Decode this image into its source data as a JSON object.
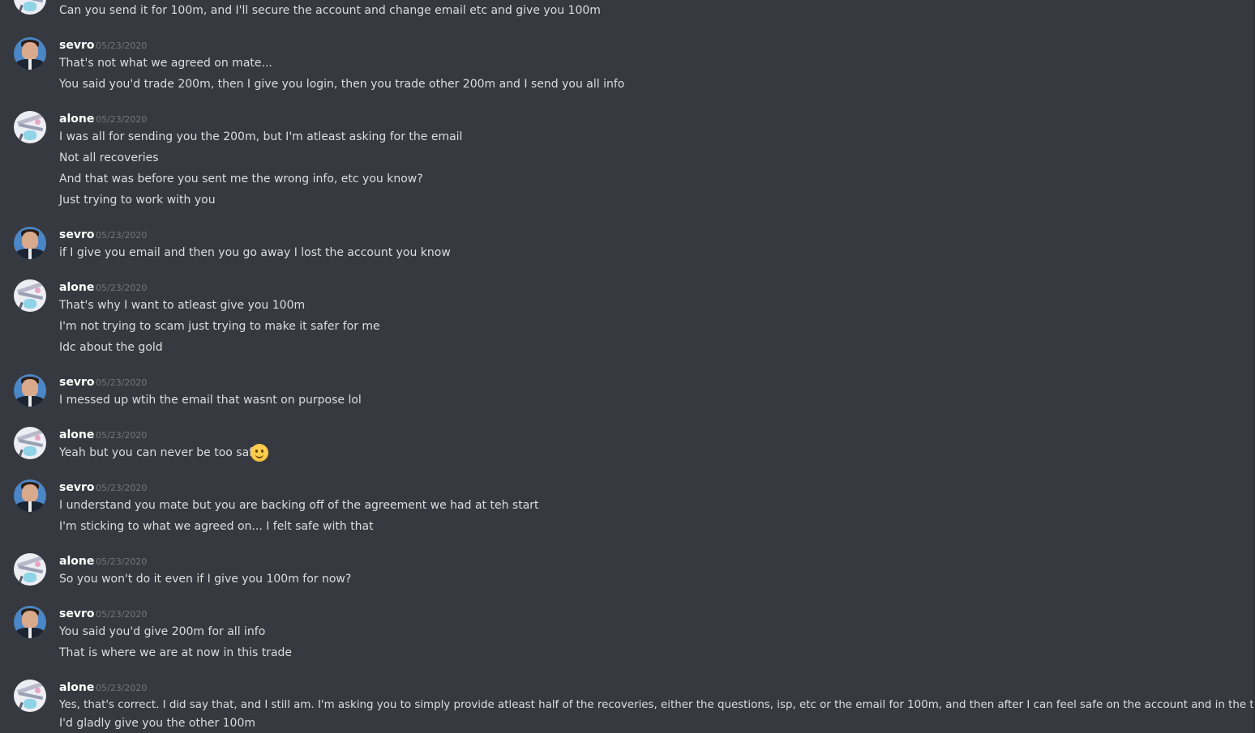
{
  "messages": [
    {
      "author": "",
      "timestamp": "",
      "avatar": "alone",
      "lines": [
        "Can you send it for 100m, and I'll secure the account and change email etc and give you 100m"
      ]
    },
    {
      "author": "sevro",
      "timestamp": "05/23/2020",
      "avatar": "sevro",
      "lines": [
        "That's not what we agreed on mate...",
        "You said you'd trade 200m, then I give you login, then you trade other 200m and I send you all info"
      ]
    },
    {
      "author": "alone",
      "timestamp": "05/23/2020",
      "avatar": "alone",
      "lines": [
        "I was all for sending you the 200m, but I'm atleast asking for the email",
        "Not all recoveries",
        "And that was before you sent me the wrong info, etc you know?",
        "Just trying to work with you"
      ]
    },
    {
      "author": "sevro",
      "timestamp": "05/23/2020",
      "avatar": "sevro",
      "lines": [
        "if I give you email and then you go away I lost the account you know"
      ]
    },
    {
      "author": "alone",
      "timestamp": "05/23/2020",
      "avatar": "alone",
      "lines": [
        "That's why I want to atleast give you 100m",
        "I'm not trying to scam just trying to make it safer for me",
        "Idc about the gold"
      ]
    },
    {
      "author": "sevro",
      "timestamp": "05/23/2020",
      "avatar": "sevro",
      "lines": [
        "I messed up wtih the email that wasnt on purpose lol"
      ]
    },
    {
      "author": "alone",
      "timestamp": "05/23/2020",
      "avatar": "alone",
      "lines": [
        "Yeah but you can never be too safe"
      ],
      "emoji": "slightly-smiling-face-icon"
    },
    {
      "author": "sevro",
      "timestamp": "05/23/2020",
      "avatar": "sevro",
      "lines": [
        "I understand you mate but you are backing off of the agreement we had at teh start",
        "I'm sticking to what we agreed on... I felt safe with that"
      ]
    },
    {
      "author": "alone",
      "timestamp": "05/23/2020",
      "avatar": "alone",
      "lines": [
        "So you won't do it even if I give you 100m for now?"
      ]
    },
    {
      "author": "sevro",
      "timestamp": "05/23/2020",
      "avatar": "sevro",
      "lines": [
        "You said you'd give 200m for all info",
        "That is where we are at now in this trade"
      ]
    },
    {
      "author": "alone",
      "timestamp": "05/23/2020",
      "avatar": "alone",
      "lines": [
        "Yes, that's correct. I did say that, and I still am. I'm asking you to simply provide atleast half of the recoveries, either the questions, isp, etc or the email for 100m, and then after I can feel safe on the account and in the trade",
        "I'd gladly give you the other 100m"
      ]
    }
  ],
  "colors": {
    "background": "#36393f",
    "author": "#ffffff",
    "message_text": "#dcddde",
    "timestamp": "#72767d",
    "sevro_avatar": "#4b86c6",
    "alone_avatar": "#eceef3"
  }
}
